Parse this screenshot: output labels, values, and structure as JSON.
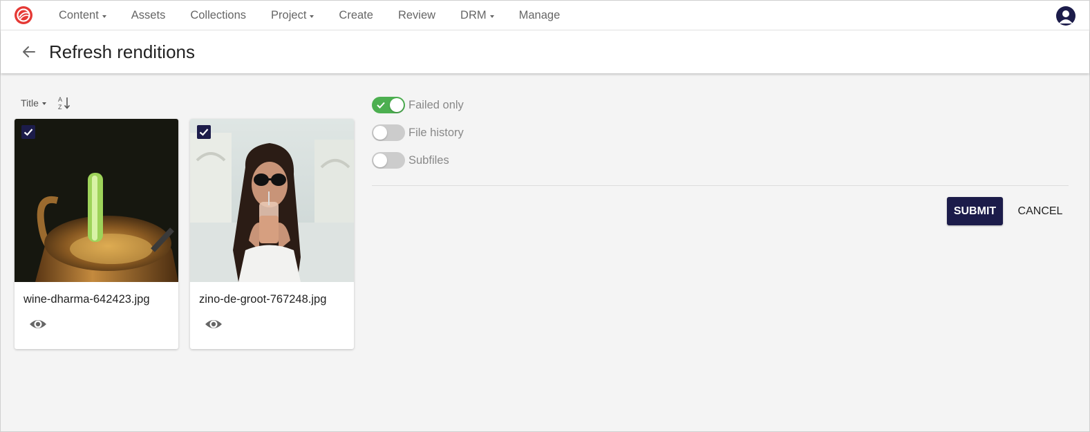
{
  "nav": {
    "items": [
      {
        "label": "Content",
        "dropdown": true
      },
      {
        "label": "Assets",
        "dropdown": false
      },
      {
        "label": "Collections",
        "dropdown": false
      },
      {
        "label": "Project",
        "dropdown": true
      },
      {
        "label": "Create",
        "dropdown": false
      },
      {
        "label": "Review",
        "dropdown": false
      },
      {
        "label": "DRM",
        "dropdown": true
      },
      {
        "label": "Manage",
        "dropdown": false
      }
    ],
    "brand_color": "#e53935"
  },
  "header": {
    "title": "Refresh renditions"
  },
  "sort": {
    "label": "Title"
  },
  "cards": [
    {
      "filename": "wine-dharma-642423.jpg",
      "checked": true
    },
    {
      "filename": "zino-de-groot-767248.jpg",
      "checked": true
    }
  ],
  "options": [
    {
      "label": "Failed only",
      "on": true
    },
    {
      "label": "File history",
      "on": false
    },
    {
      "label": "Subfiles",
      "on": false
    }
  ],
  "actions": {
    "submit_label": "SUBMIT",
    "cancel_label": "CANCEL"
  },
  "colors": {
    "primary": "#1c1c4a",
    "toggle_on": "#4caf50",
    "toggle_off": "#cccccc"
  }
}
